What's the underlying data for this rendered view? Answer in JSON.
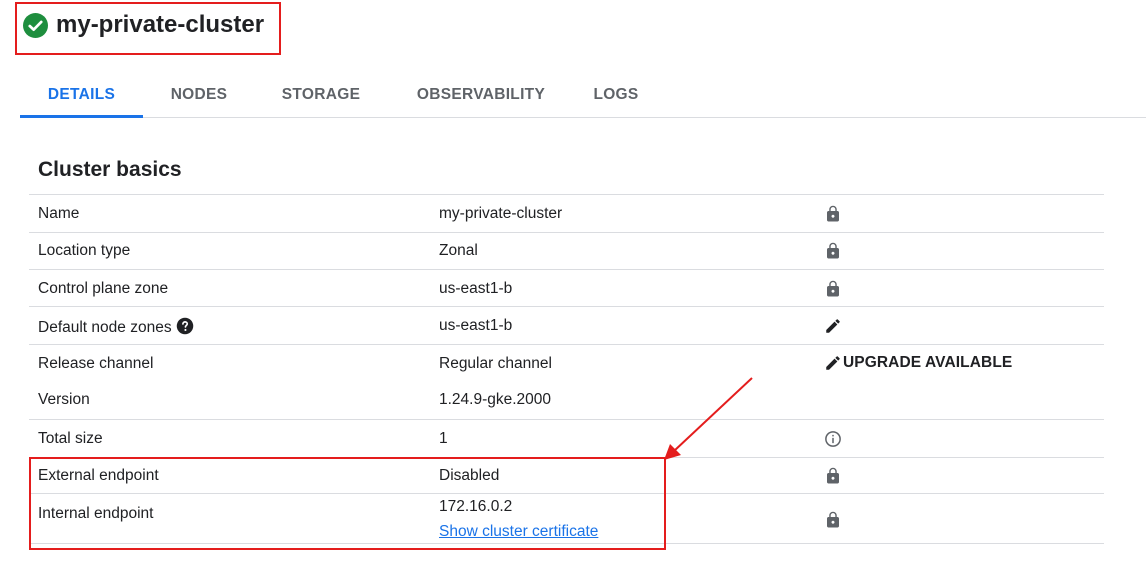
{
  "header": {
    "title": "my-private-cluster",
    "status_icon": "check-circle-icon",
    "status_color": "#1e8e3e"
  },
  "tabs": [
    {
      "label": "DETAILS",
      "active": true
    },
    {
      "label": "NODES",
      "active": false
    },
    {
      "label": "STORAGE",
      "active": false
    },
    {
      "label": "OBSERVABILITY",
      "active": false
    },
    {
      "label": "LOGS",
      "active": false
    }
  ],
  "section": {
    "title": "Cluster basics",
    "rows": [
      {
        "label": "Name",
        "value": "my-private-cluster",
        "action_icon": "lock-icon"
      },
      {
        "label": "Location type",
        "value": "Zonal",
        "action_icon": "lock-icon"
      },
      {
        "label": "Control plane zone",
        "value": "us-east1-b",
        "action_icon": "lock-icon"
      },
      {
        "label": "Default node zones",
        "value": "us-east1-b",
        "action_icon": "edit-icon",
        "help_icon": "help-icon"
      },
      {
        "label": "Release channel",
        "value": "Regular channel",
        "action_icon": "edit-icon",
        "action_label": "UPGRADE AVAILABLE"
      },
      {
        "label": "Version",
        "value": "1.24.9-gke.2000"
      },
      {
        "label": "Total size",
        "value": "1",
        "action_icon": "info-icon"
      },
      {
        "label": "External endpoint",
        "value": "Disabled",
        "action_icon": "lock-icon"
      },
      {
        "label": "Internal endpoint",
        "value": "172.16.0.2",
        "link": "Show cluster certificate",
        "action_icon": "lock-icon"
      }
    ]
  },
  "colors": {
    "accent": "#1a73e8",
    "annotation": "#e41d1d",
    "icon_gray": "#5f6368"
  }
}
